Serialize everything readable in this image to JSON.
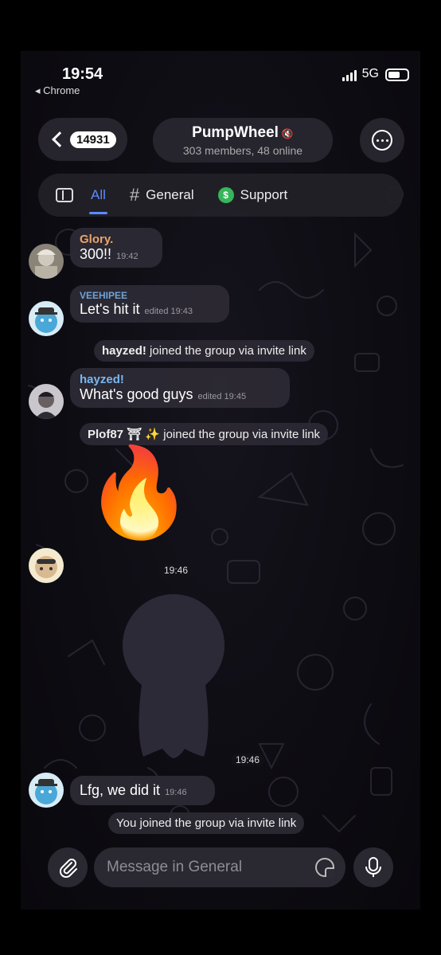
{
  "status_bar": {
    "time": "19:54",
    "back_app": "◂ Chrome",
    "network": "5G"
  },
  "header": {
    "back_count": "14931",
    "title": "PumpWheel",
    "mute_symbol": "🔇",
    "subtitle": "303 members, 48 online",
    "more_icon": "ellipsis-icon"
  },
  "tabs": [
    {
      "label": "All",
      "active": true,
      "icon": "panel-icon"
    },
    {
      "label": "General",
      "active": false,
      "icon": "hashtag-icon"
    },
    {
      "label": "Support",
      "active": false,
      "icon": "support-icon"
    }
  ],
  "messages": [
    {
      "sender": "Glory.",
      "sender_color": "#e8a56a",
      "text": "300!!",
      "time": "19:42"
    },
    {
      "sender": "VEEHIPEE",
      "sender_color": "#6fa3d8",
      "text": "Let's hit it",
      "time": "edited 19:43"
    },
    {
      "service": "joined the group via invite link",
      "actor": "hayzed!"
    },
    {
      "sender": "hayzed!",
      "sender_color": "#7ab7f0",
      "text": "What's good guys",
      "time": "edited 19:45"
    },
    {
      "service": "joined the group via invite link",
      "actor": "Plof87 ⛩ ✨"
    },
    {
      "sticker": "🔥",
      "time": "19:46"
    },
    {
      "sticker": "silhouette-sticker",
      "time": "19:46"
    },
    {
      "text": "Lfg, we did it",
      "time": "19:46"
    },
    {
      "service": "You joined the group via invite link"
    }
  ],
  "input": {
    "placeholder": "Message in General"
  },
  "colors": {
    "accent": "#5a8cff",
    "bubble": "#2c2a34",
    "background": "#0d0c12"
  }
}
